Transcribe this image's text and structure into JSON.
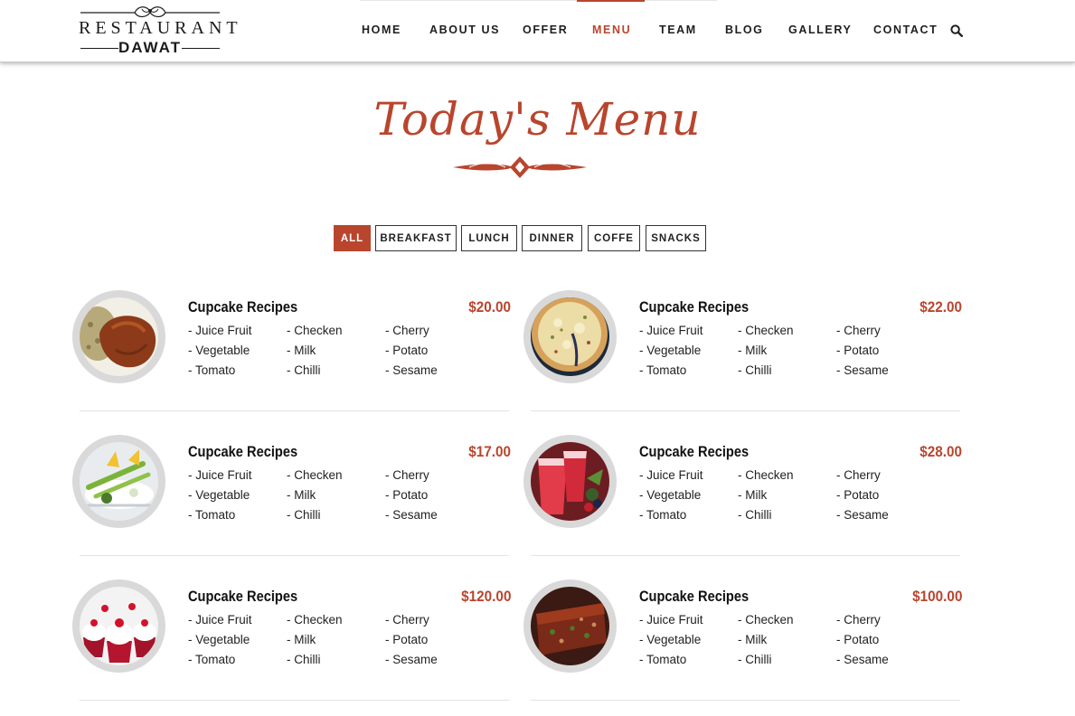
{
  "brand": {
    "logo_top": "RESTAURANT",
    "logo_bottom": "DAWAT"
  },
  "nav": {
    "items": [
      {
        "label": "HOME"
      },
      {
        "label": "ABOUT US"
      },
      {
        "label": "OFFER"
      },
      {
        "label": "MENU",
        "active": true
      },
      {
        "label": "TEAM"
      },
      {
        "label": "BLOG"
      },
      {
        "label": "GALLERY"
      },
      {
        "label": "CONTACT"
      }
    ],
    "search_icon": "search-icon"
  },
  "section": {
    "title": "Today's Menu"
  },
  "filters": [
    {
      "label": "ALL",
      "active": true
    },
    {
      "label": "BREAKFAST"
    },
    {
      "label": "LUNCH"
    },
    {
      "label": "DINNER"
    },
    {
      "label": "COFFE"
    },
    {
      "label": "SNACKS"
    }
  ],
  "menu": [
    {
      "name": "Cupcake Recipes",
      "price": "$20.00",
      "image": "roast-chicken",
      "ingredients": [
        "- Juice Fruit",
        "- Checken",
        "- Cherry",
        "- Vegetable",
        "- Milk",
        "- Potato",
        "- Tomato",
        "- Chilli",
        "- Sesame"
      ]
    },
    {
      "name": "Cupcake Recipes",
      "price": "$22.00",
      "image": "pizza",
      "ingredients": [
        "- Juice Fruit",
        "- Checken",
        "- Cherry",
        "- Vegetable",
        "- Milk",
        "- Potato",
        "- Tomato",
        "- Chilli",
        "- Sesame"
      ]
    },
    {
      "name": "Cupcake Recipes",
      "price": "$17.00",
      "image": "salad-plate",
      "ingredients": [
        "- Juice Fruit",
        "- Checken",
        "- Cherry",
        "- Vegetable",
        "- Milk",
        "- Potato",
        "- Tomato",
        "- Chilli",
        "- Sesame"
      ]
    },
    {
      "name": "Cupcake Recipes",
      "price": "$28.00",
      "image": "berry-drinks",
      "ingredients": [
        "- Juice Fruit",
        "- Checken",
        "- Cherry",
        "- Vegetable",
        "- Milk",
        "- Potato",
        "- Tomato",
        "- Chilli",
        "- Sesame"
      ]
    },
    {
      "name": "Cupcake Recipes",
      "price": "$120.00",
      "image": "red-velvet-cupcakes",
      "ingredients": [
        "- Juice Fruit",
        "- Checken",
        "- Cherry",
        "- Vegetable",
        "- Milk",
        "- Potato",
        "- Tomato",
        "- Chilli",
        "- Sesame"
      ]
    },
    {
      "name": "Cupcake Recipes",
      "price": "$100.00",
      "image": "meatloaf",
      "ingredients": [
        "- Juice Fruit",
        "- Checken",
        "- Cherry",
        "- Vegetable",
        "- Milk",
        "- Potato",
        "- Tomato",
        "- Chilli",
        "- Sesame"
      ]
    }
  ],
  "colors": {
    "accent": "#b9452d",
    "text": "#222222",
    "thumb_ring": "#d9d9d9",
    "rule": "#e3e3e3"
  }
}
